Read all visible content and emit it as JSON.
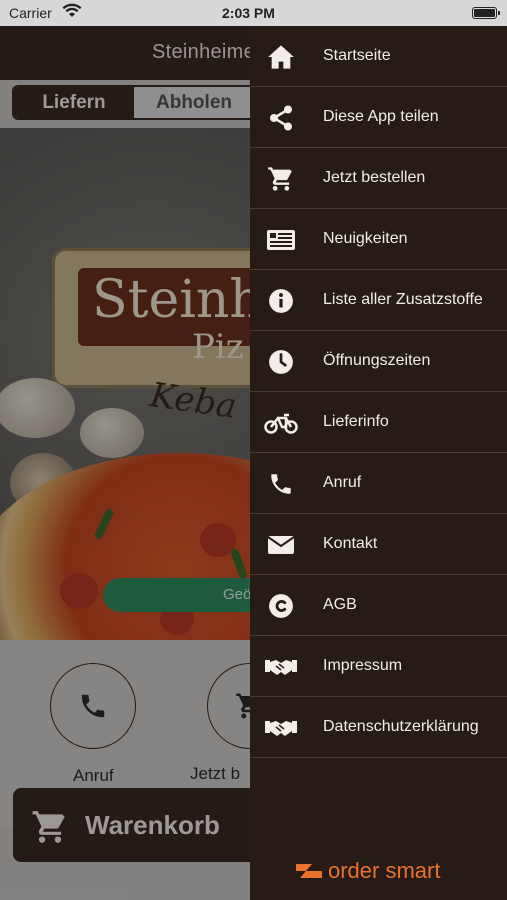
{
  "status_bar": {
    "carrier": "Carrier",
    "time": "2:03 PM"
  },
  "app": {
    "title": "Steinheime",
    "tabs": [
      {
        "label": "Liefern",
        "active": true
      },
      {
        "label": "Abholen",
        "active": false
      }
    ],
    "logo": {
      "line1": "Steinh",
      "line2": "Piz",
      "line3": "Keba"
    },
    "badge_text": "Geö",
    "actions": [
      {
        "label": "Anruf",
        "icon": "phone-icon"
      },
      {
        "label": "Jetzt b",
        "icon": "cart-icon"
      }
    ],
    "cart": {
      "label": "Warenkorb",
      "icon": "cart-icon"
    }
  },
  "drawer": {
    "items": [
      {
        "label": "Startseite",
        "icon": "home-icon"
      },
      {
        "label": "Diese App teilen",
        "icon": "share-icon"
      },
      {
        "label": "Jetzt bestellen",
        "icon": "cart-icon"
      },
      {
        "label": "Neuigkeiten",
        "icon": "news-icon"
      },
      {
        "label": "Liste aller Zusatzstoffe",
        "icon": "info-icon"
      },
      {
        "label": "Öffnungszeiten",
        "icon": "clock-icon"
      },
      {
        "label": "Lieferinfo",
        "icon": "motorbike-icon"
      },
      {
        "label": "Anruf",
        "icon": "phone-icon"
      },
      {
        "label": "Kontakt",
        "icon": "envelope-icon"
      },
      {
        "label": "AGB",
        "icon": "copyright-icon"
      },
      {
        "label": "Impressum",
        "icon": "handshake-icon"
      },
      {
        "label": "Datenschutzerklärung",
        "icon": "handshake-icon"
      }
    ],
    "brand": "order smart"
  },
  "colors": {
    "drawer_bg": "#271b16",
    "header_bg": "#3a2a22",
    "brand_orange": "#e8722b",
    "badge_green": "#2f8a5e"
  }
}
